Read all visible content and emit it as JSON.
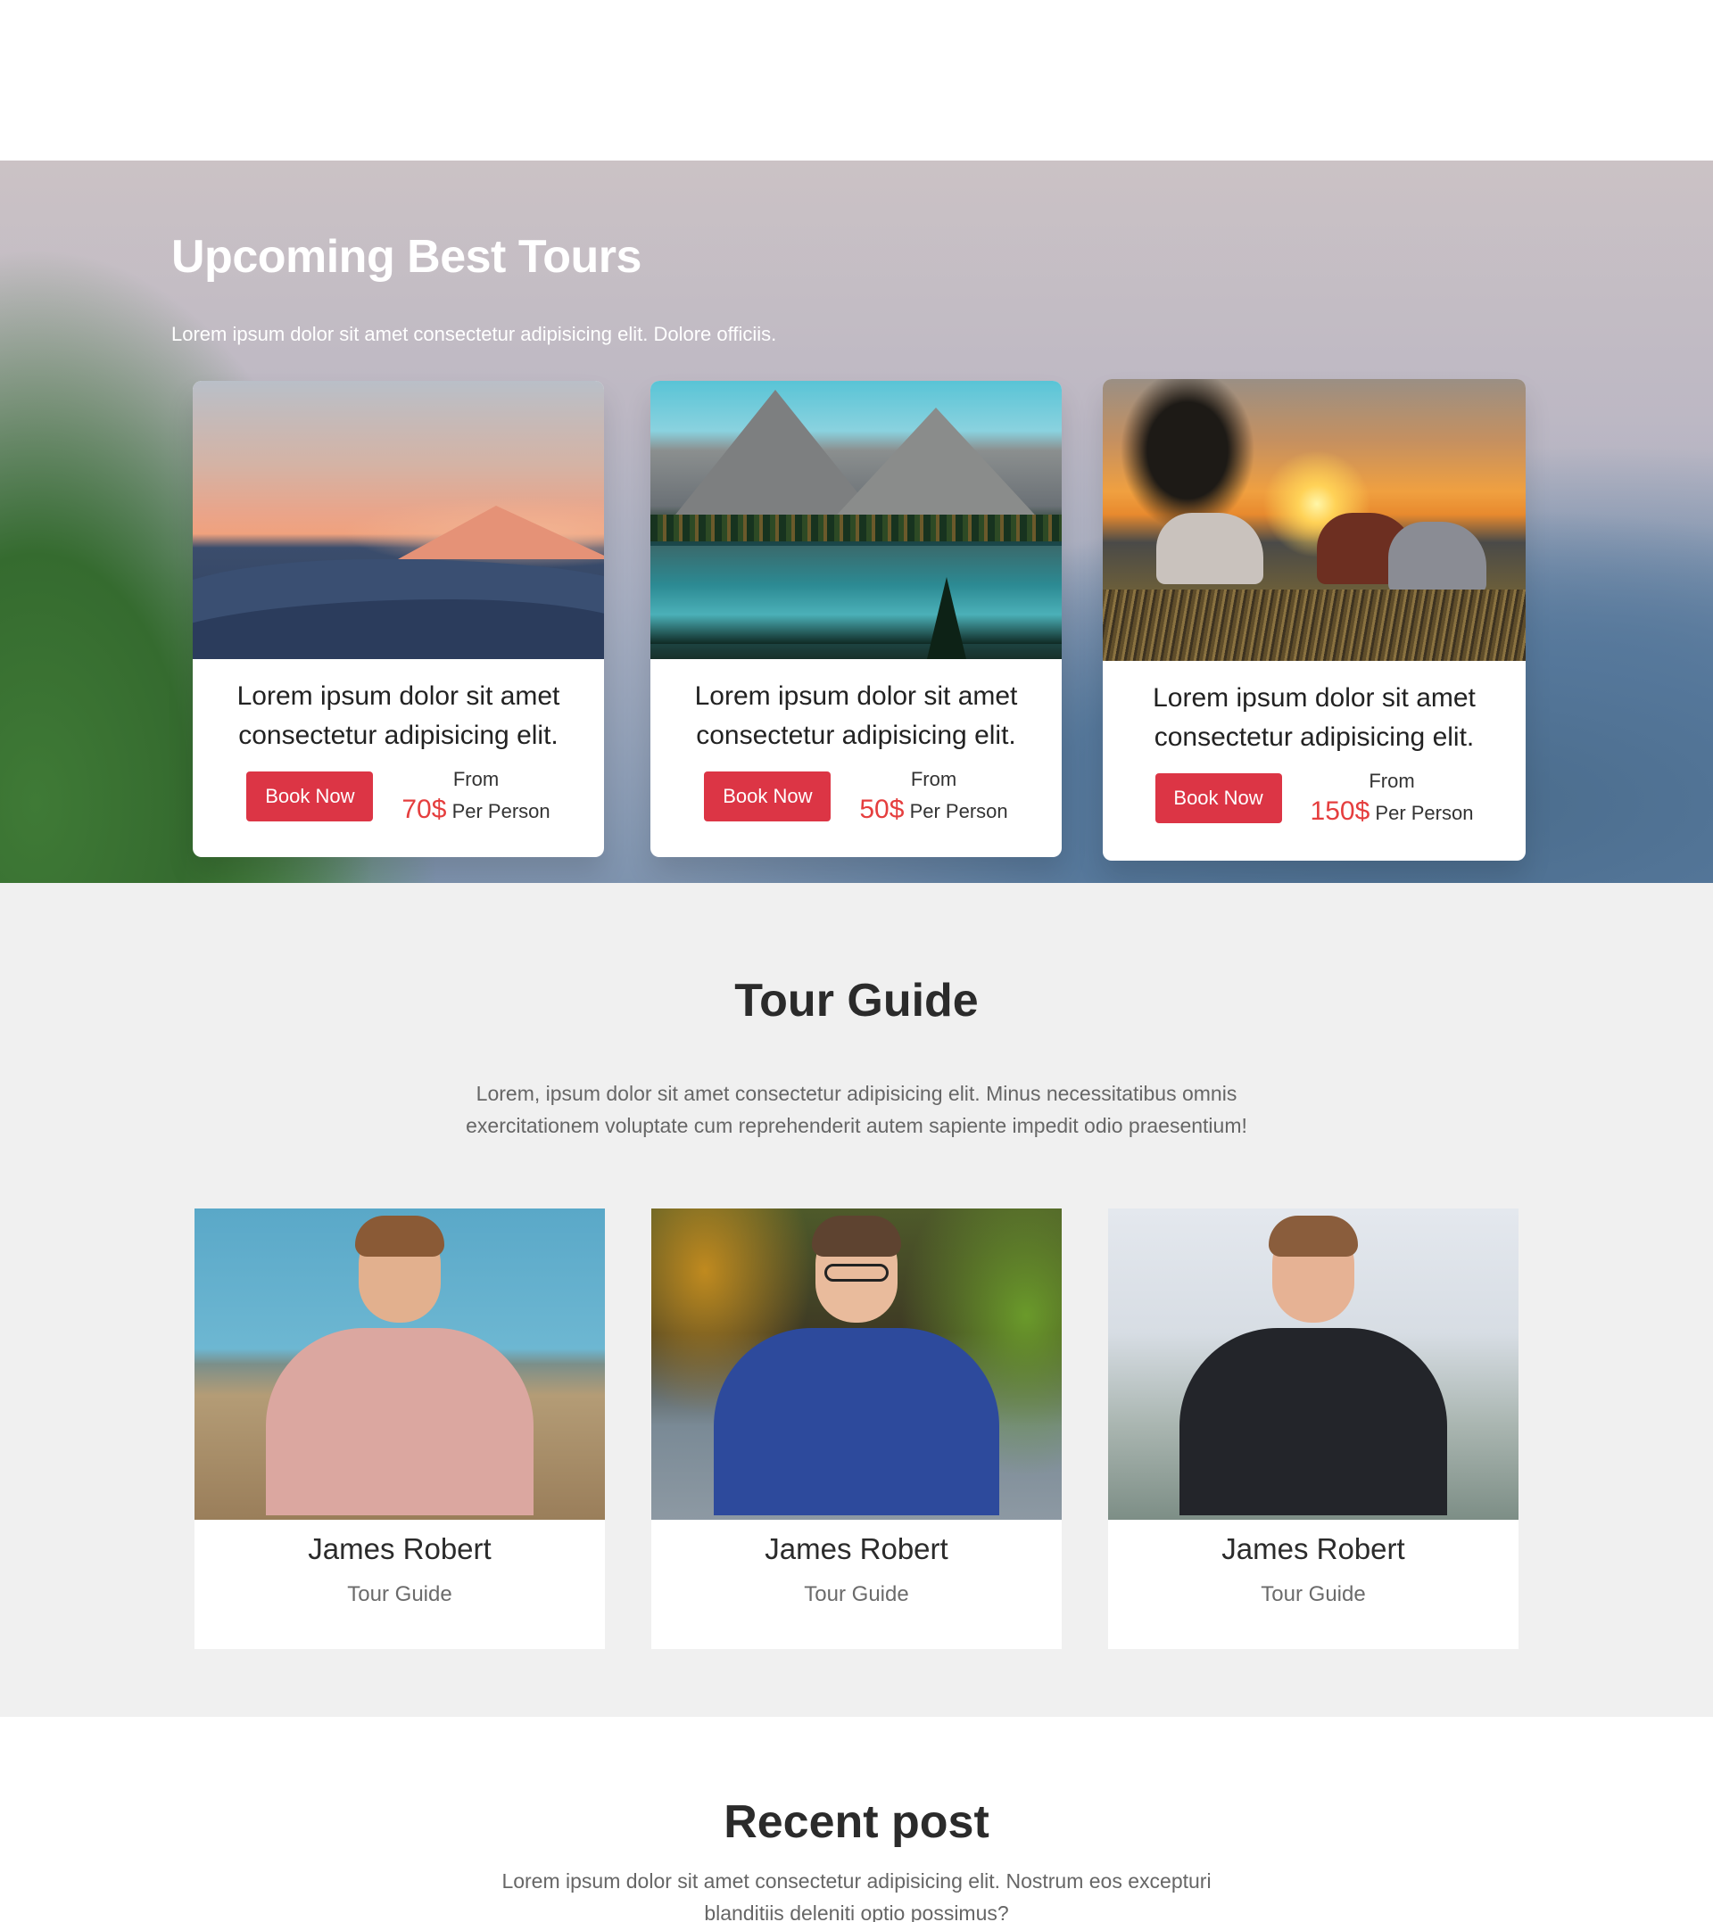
{
  "tours": {
    "title": "Upcoming Best Tours",
    "subtitle": "Lorem ipsum dolor sit amet consectetur adipisicing elit. Dolore officiis.",
    "cards": [
      {
        "desc": "Lorem ipsum dolor sit amet consectetur adipisicing elit.",
        "button": "Book Now",
        "from": "From",
        "price": "70$",
        "per": "Per Person"
      },
      {
        "desc": "Lorem ipsum dolor sit amet consectetur adipisicing elit.",
        "button": "Book Now",
        "from": "From",
        "price": "50$",
        "per": "Per Person"
      },
      {
        "desc": "Lorem ipsum dolor sit amet consectetur adipisicing elit.",
        "button": "Book Now",
        "from": "From",
        "price": "150$",
        "per": "Per Person"
      }
    ]
  },
  "guides": {
    "title": "Tour Guide",
    "description": "Lorem, ipsum dolor sit amet consectetur adipisicing elit. Minus necessitatibus omnis exercitationem voluptate cum reprehenderit autem sapiente impedit odio praesentium!",
    "cards": [
      {
        "name": "James Robert",
        "role": "Tour Guide"
      },
      {
        "name": "James Robert",
        "role": "Tour Guide"
      },
      {
        "name": "James Robert",
        "role": "Tour Guide"
      }
    ]
  },
  "recent": {
    "title": "Recent post",
    "description": "Lorem ipsum dolor sit amet consectetur adipisicing elit. Nostrum eos excepturi blanditiis deleniti optio possimus?"
  },
  "colors": {
    "accent": "#dc3545",
    "price": "#e53e3e",
    "section_bg": "#f0f0f0"
  }
}
